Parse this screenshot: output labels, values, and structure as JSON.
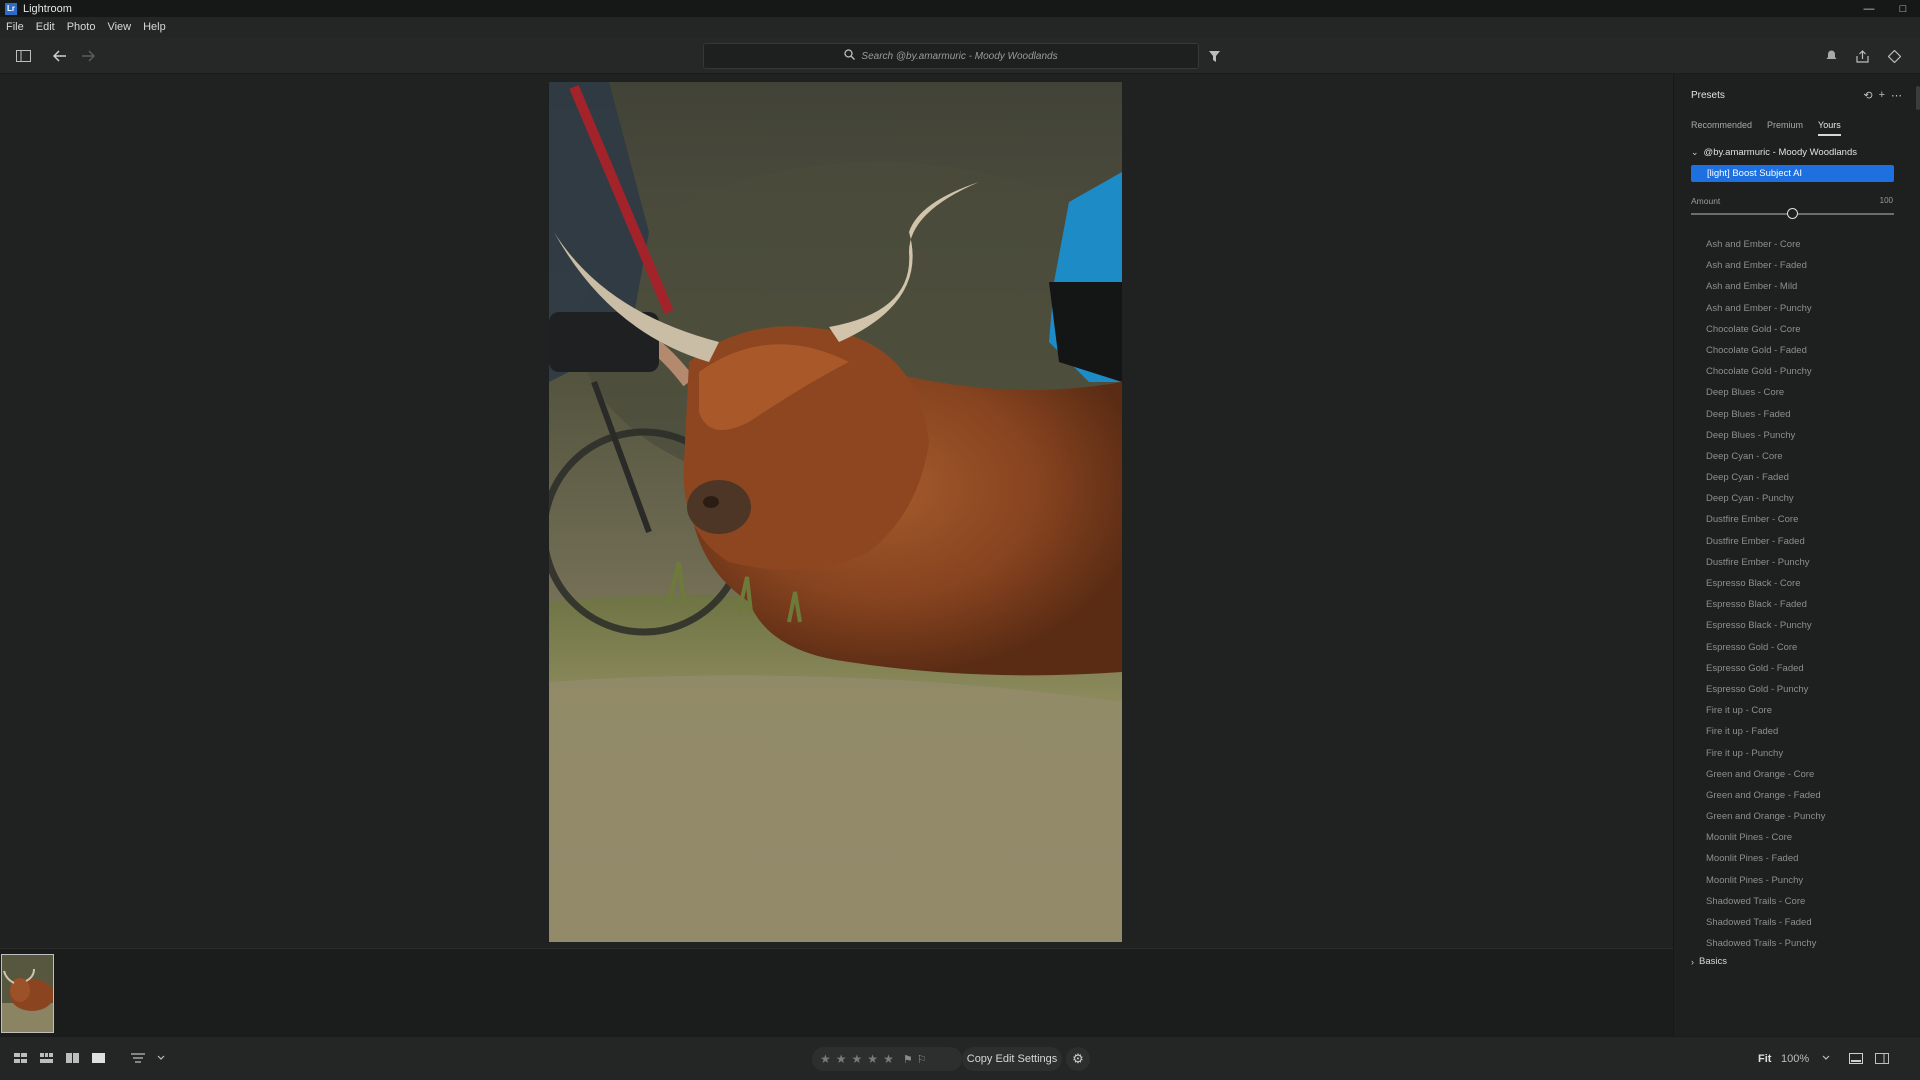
{
  "window": {
    "title": "Lightroom",
    "logo_text": "Lr"
  },
  "menu": [
    "File",
    "Edit",
    "Photo",
    "View",
    "Help"
  ],
  "search": {
    "placeholder": "Search @by.amarmuric - Moody Woodlands"
  },
  "presets_panel": {
    "title": "Presets",
    "tabs": [
      {
        "label": "Recommended",
        "active": false
      },
      {
        "label": "Premium",
        "active": false
      },
      {
        "label": "Yours",
        "active": true
      }
    ],
    "group_name": "@by.amarmuric - Moody Woodlands",
    "selected_preset": "[light] Boost Subject AI",
    "amount": {
      "label": "Amount",
      "value": "100",
      "level": 0.5
    },
    "presets": [
      "Ash and Ember - Core",
      "Ash and Ember - Faded",
      "Ash and Ember - Mild",
      "Ash and Ember - Punchy",
      "Chocolate Gold - Core",
      "Chocolate Gold - Faded",
      "Chocolate Gold - Punchy",
      "Deep Blues - Core",
      "Deep Blues - Faded",
      "Deep Blues - Punchy",
      "Deep Cyan - Core",
      "Deep Cyan - Faded",
      "Deep Cyan - Punchy",
      "Dustfire Ember - Core",
      "Dustfire Ember - Faded",
      "Dustfire Ember - Punchy",
      "Espresso Black - Core",
      "Espresso Black - Faded",
      "Espresso Black - Punchy",
      "Espresso Gold - Core",
      "Espresso Gold - Faded",
      "Espresso Gold - Punchy",
      "Fire it up - Core",
      "Fire it up - Faded",
      "Fire it up - Punchy",
      "Green and Orange - Core",
      "Green and Orange - Faded",
      "Green and Orange - Punchy",
      "Moonlit Pines - Core",
      "Moonlit Pines - Faded",
      "Moonlit Pines - Punchy",
      "Shadowed Trails - Core",
      "Shadowed Trails - Faded",
      "Shadowed Trails - Punchy"
    ],
    "next_section": "Basics"
  },
  "bottom_bar": {
    "rating_stars": 5,
    "copy_button": "Copy Edit Settings",
    "zoom_mode": "Fit",
    "zoom_percent": "100%"
  },
  "colors": {
    "accent": "#1e6fe0",
    "background": "#1f2220",
    "panel": "#1d201e"
  },
  "icons": [
    "panel-toggle-icon",
    "back-arrow-icon",
    "forward-arrow-icon",
    "search-icon",
    "filter-icon",
    "bell-icon",
    "share-icon",
    "tag-icon",
    "gear-icon",
    "grid-view-icon",
    "compare-view-icon",
    "loupe-view-icon",
    "sort-icon",
    "filmstrip-toggle-icon",
    "panel-split-icon"
  ]
}
